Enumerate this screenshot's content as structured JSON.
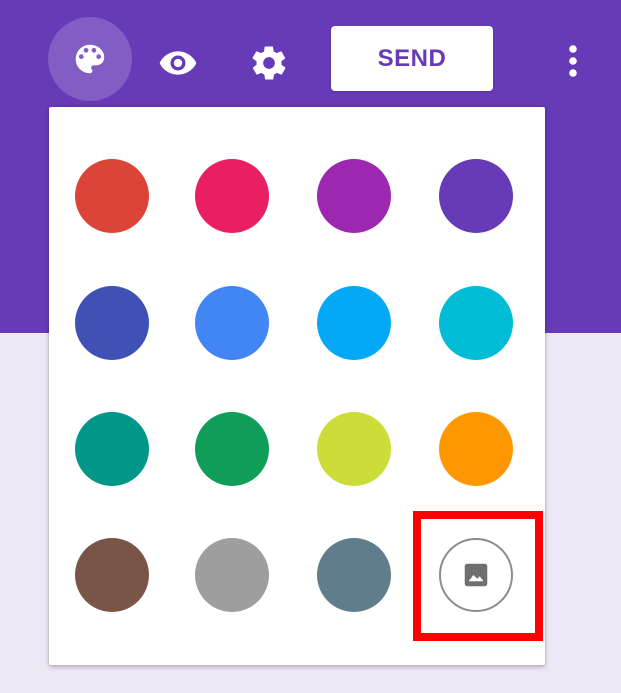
{
  "colors": {
    "header": "#673ab7",
    "page_background": "#ede7f6",
    "accent": "#673ab7",
    "highlight": "#ff0000"
  },
  "toolbar": {
    "send_label": "SEND",
    "icons": {
      "palette": "palette-icon",
      "preview": "eye-icon",
      "settings": "gear-icon",
      "more": "more-vertical-icon"
    }
  },
  "palette": {
    "rows": [
      [
        "#db4437",
        "#e91e63",
        "#9c27b0",
        "#673ab7"
      ],
      [
        "#3f51b5",
        "#4285f4",
        "#03a9f4",
        "#00bcd4"
      ],
      [
        "#009688",
        "#0f9d58",
        "#cddc39",
        "#ff9800"
      ],
      [
        "#795548",
        "#9e9e9e",
        "#607d8b"
      ]
    ],
    "image_option_icon": "image-icon"
  }
}
